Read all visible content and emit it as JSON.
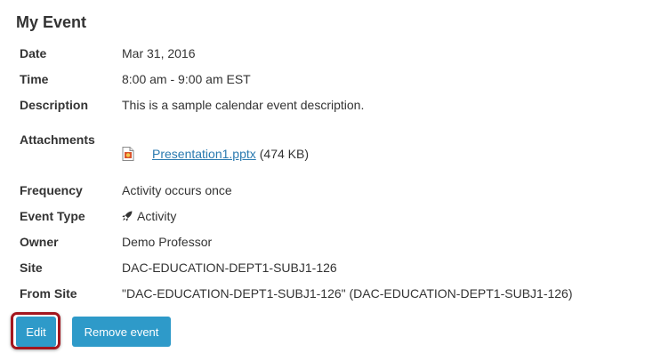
{
  "event": {
    "title": "My Event",
    "fields": {
      "date": {
        "label": "Date",
        "value": "Mar 31, 2016"
      },
      "time": {
        "label": "Time",
        "value": "8:00 am - 9:00 am EST"
      },
      "description": {
        "label": "Description",
        "value": "This is a sample calendar event description."
      },
      "attachments": {
        "label": "Attachments",
        "file_name": "Presentation1.pptx",
        "file_size": "(474 KB)"
      },
      "frequency": {
        "label": "Frequency",
        "value": "Activity occurs once"
      },
      "event_type": {
        "label": "Event Type",
        "value": "Activity",
        "icon": "rocket-icon"
      },
      "owner": {
        "label": "Owner",
        "value": "Demo Professor"
      },
      "site": {
        "label": "Site",
        "value": "DAC-EDUCATION-DEPT1-SUBJ1-126"
      },
      "from_site": {
        "label": "From Site",
        "value": "\"DAC-EDUCATION-DEPT1-SUBJ1-126\" (DAC-EDUCATION-DEPT1-SUBJ1-126)"
      }
    }
  },
  "actions": {
    "edit_label": "Edit",
    "remove_label": "Remove event"
  },
  "colors": {
    "button": "#2e9ac9",
    "highlight": "#a3161e",
    "link": "#2a7ab0"
  }
}
